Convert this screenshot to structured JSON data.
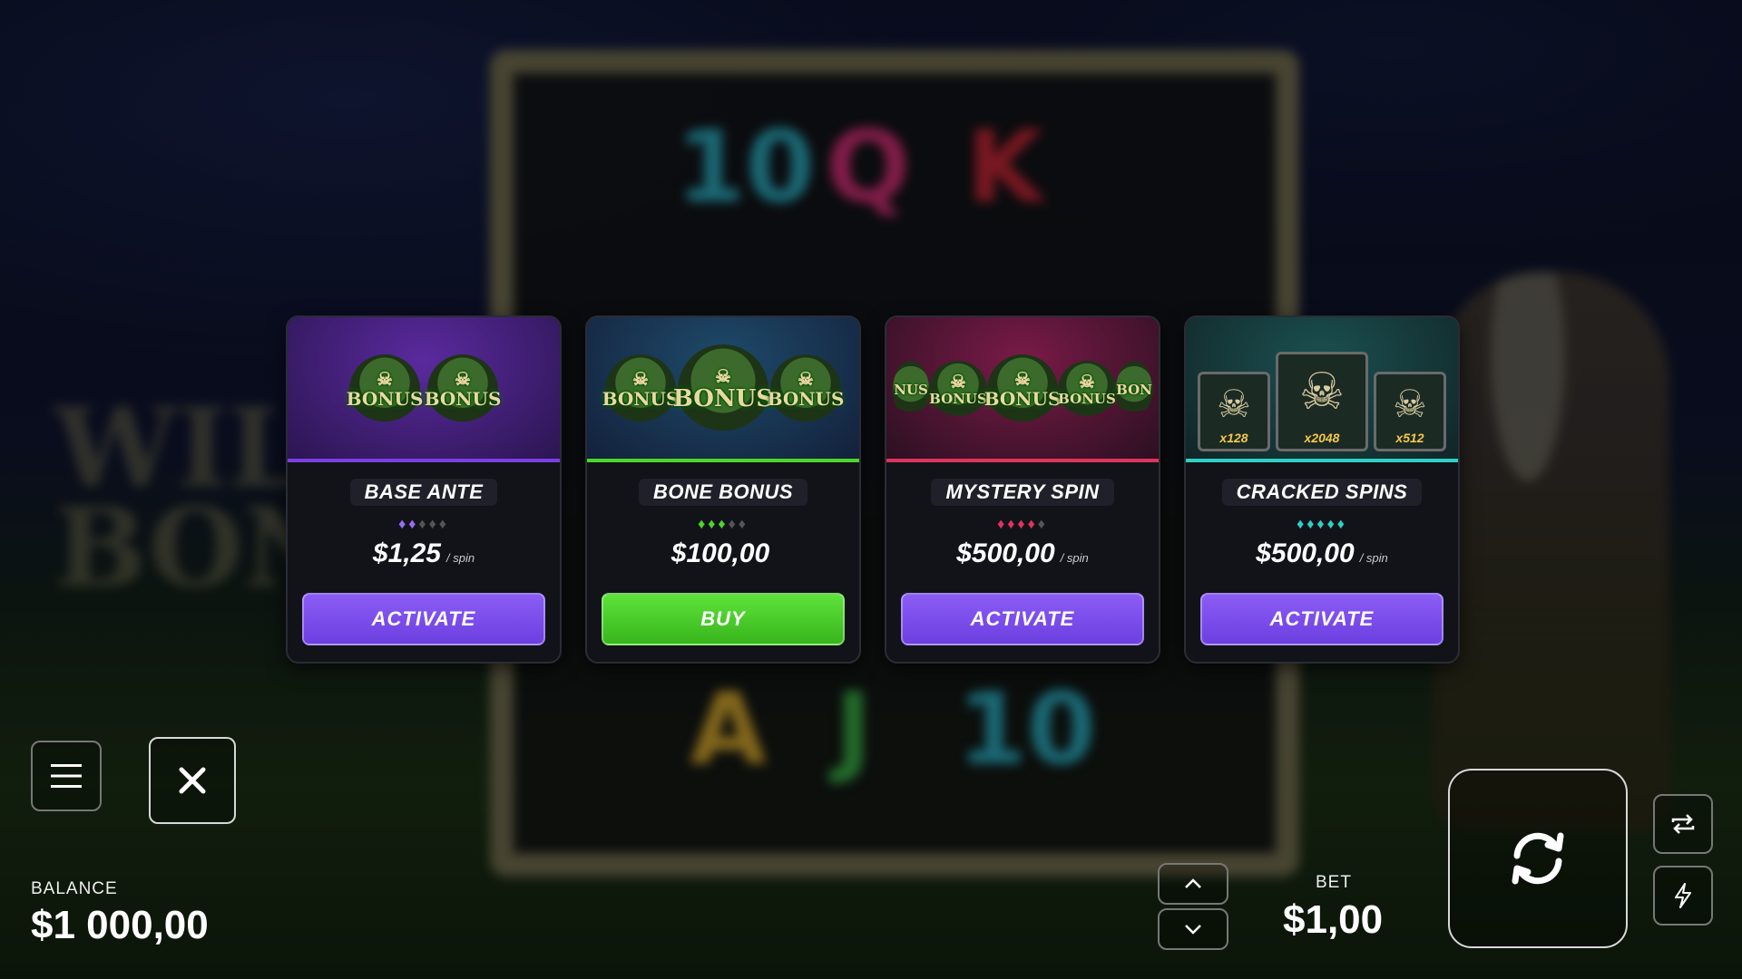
{
  "cards": [
    {
      "title": "BASE ANTE",
      "art": [
        "BONUS",
        "BONUS"
      ],
      "price": "$1,25",
      "unit": "/ spin",
      "button": "ACTIVATE",
      "accent": "#7b3fe4",
      "rating_filled": 2,
      "rating_total": 5
    },
    {
      "title": "BONE BONUS",
      "art": [
        "BONUS",
        "BONUS",
        "BONUS"
      ],
      "price": "$100,00",
      "unit": "",
      "button": "BUY",
      "accent": "#4cd62a",
      "rating_filled": 3,
      "rating_total": 5
    },
    {
      "title": "MYSTERY SPIN",
      "art": [
        "NUS",
        "BONUS",
        "BONUS",
        "BONUS",
        "BON"
      ],
      "price": "$500,00",
      "unit": "/ spin",
      "button": "ACTIVATE",
      "accent": "#e0335e",
      "rating_filled": 4,
      "rating_total": 5
    },
    {
      "title": "CRACKED SPINS",
      "art_multipliers": [
        "x128",
        "x2048",
        "x512"
      ],
      "price": "$500,00",
      "unit": "/ spin",
      "button": "ACTIVATE",
      "accent": "#2fd0c4",
      "rating_filled": 5,
      "rating_total": 5
    }
  ],
  "background_symbols": [
    "10",
    "Q",
    "K",
    "A",
    "J",
    "10"
  ],
  "background_logo": [
    "WIL",
    "BON"
  ],
  "controls": {
    "menu_icon": "hamburger-icon",
    "close_icon": "close-icon",
    "balance_label": "BALANCE",
    "balance_value": "$1 000,00",
    "bet_label": "BET",
    "bet_value": "$1,00",
    "bet_up_icon": "chevron-up-icon",
    "bet_down_icon": "chevron-down-icon",
    "spin_icon": "refresh-icon",
    "autoplay_icon": "repeat-icon",
    "turbo_icon": "lightning-icon"
  }
}
